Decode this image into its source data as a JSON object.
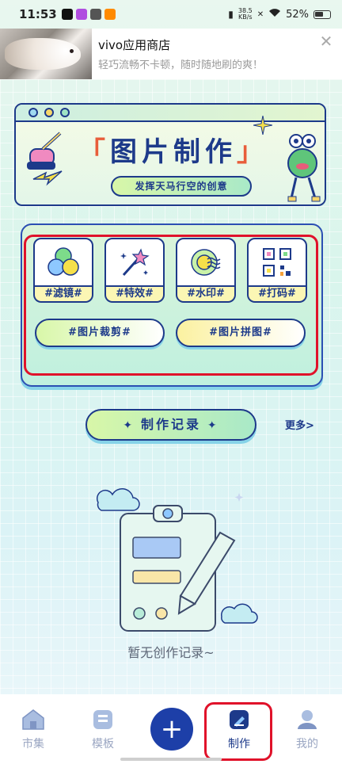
{
  "status_bar": {
    "time": "11:53",
    "net_speed_value": "38.5",
    "net_speed_unit": "KB/s",
    "battery": "52%"
  },
  "notification": {
    "title": "vivo应用商店",
    "body": "轻巧流畅不卡顿，随时随地刷的爽！",
    "close_icon": "✕"
  },
  "banner": {
    "title": "图片制作",
    "bracket_open": "「",
    "bracket_close": "」",
    "subtitle": "发挥天马行空的创意"
  },
  "tools": {
    "items": [
      {
        "label": "#滤镜#",
        "icon": "filter-circles-icon"
      },
      {
        "label": "#特效#",
        "icon": "magic-wand-icon"
      },
      {
        "label": "#水印#",
        "icon": "watermark-icon"
      },
      {
        "label": "#打码#",
        "icon": "qr-code-icon"
      }
    ],
    "crop_label": "#图片裁剪#",
    "collage_label": "#图片拼图#"
  },
  "records": {
    "title": "制作记录",
    "more": "更多>",
    "empty_text": "暂无创作记录~"
  },
  "bottom_nav": {
    "items": [
      {
        "label": "市集",
        "icon": "home-icon"
      },
      {
        "label": "模板",
        "icon": "template-icon"
      },
      {
        "label": "制作",
        "icon": "create-icon",
        "active": true
      },
      {
        "label": "我的",
        "icon": "profile-icon"
      }
    ],
    "plus": "+"
  },
  "colors": {
    "primary": "#1d3a8a",
    "highlight": "#e0122a",
    "accent_green": "#a9e9c8",
    "accent_yellow": "#fbf6b4"
  }
}
